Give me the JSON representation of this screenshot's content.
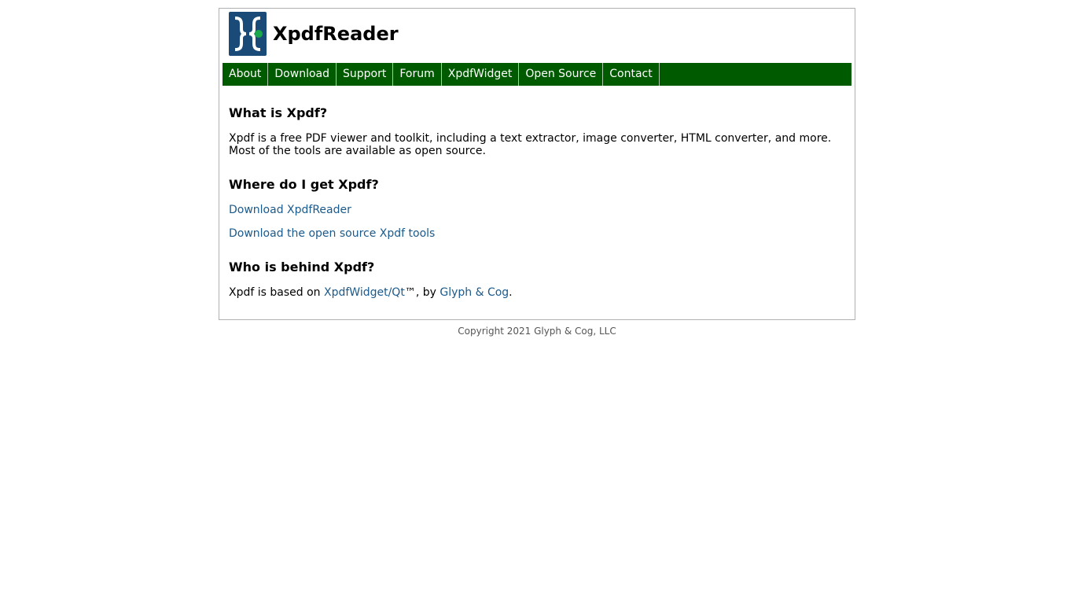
{
  "header": {
    "brand": "XpdfReader",
    "logo_icon": "xpdf-logo-icon"
  },
  "nav": {
    "items": [
      {
        "label": "About"
      },
      {
        "label": "Download"
      },
      {
        "label": "Support"
      },
      {
        "label": "Forum"
      },
      {
        "label": "XpdfWidget"
      },
      {
        "label": "Open Source"
      },
      {
        "label": "Contact"
      }
    ]
  },
  "content": {
    "what_heading": "What is Xpdf?",
    "what_text": "Xpdf is a free PDF viewer and toolkit, including a text extractor, image converter, HTML converter, and more. Most of the tools are available as open source.",
    "where_heading": "Where do I get Xpdf?",
    "link_reader": "Download XpdfReader",
    "link_tools": "Download the open source Xpdf tools",
    "who_heading": "Who is behind Xpdf?",
    "who_prefix": "Xpdf is based on ",
    "who_link1": "XpdfWidget/Qt",
    "who_mid": "™, by ",
    "who_link2": "Glyph & Cog",
    "who_suffix": "."
  },
  "footer": {
    "copyright": "Copyright 2021 Glyph & Cog, LLC"
  },
  "colors": {
    "nav_bg": "#005a00",
    "link": "#1a5a8c",
    "logo_blue": "#1a4a78",
    "logo_green": "#1aa84a"
  }
}
